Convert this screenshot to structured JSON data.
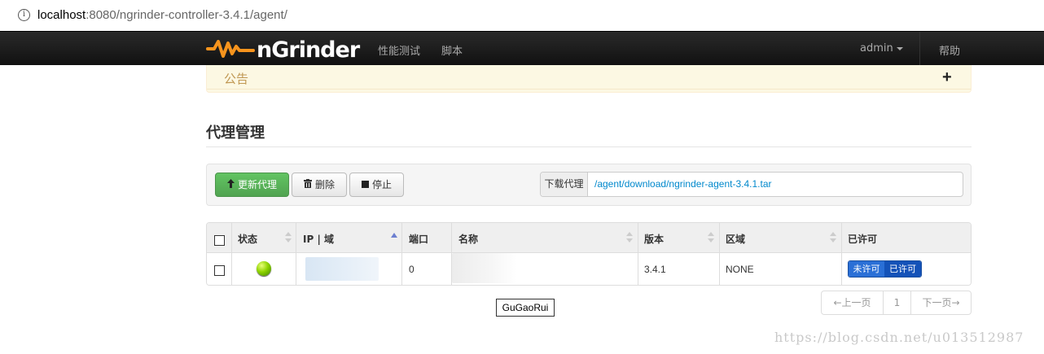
{
  "browser": {
    "url_host": "localhost",
    "url_rest": ":8080/ngrinder-controller-3.4.1/agent/",
    "info_glyph": "i"
  },
  "navbar": {
    "brand": "nGrinder",
    "items": [
      {
        "label": "性能测试"
      },
      {
        "label": "脚本"
      }
    ],
    "user": "admin",
    "help": "帮助",
    "logo_color": "#f7941d"
  },
  "notice": {
    "title": "公告",
    "expand_symbol": "+"
  },
  "page": {
    "title": "代理管理"
  },
  "toolbar": {
    "update_label": "更新代理",
    "delete_label": "删除",
    "stop_label": "停止",
    "download_label": "下载代理",
    "download_link": "/agent/download/ngrinder-agent-3.4.1.tar"
  },
  "table": {
    "headers": {
      "status": "状态",
      "ip": "IP | 域",
      "port": "端口",
      "name": "名称",
      "version": "版本",
      "region": "区域",
      "approved": "已许可"
    },
    "rows": [
      {
        "status": "green",
        "port": "0",
        "version": "3.4.1",
        "region": "NONE",
        "toggle_off": "未许可",
        "toggle_on": "已许可"
      }
    ]
  },
  "pagination": {
    "prev": "←上一页",
    "page": "1",
    "next": "下一页→"
  },
  "tooltip": "GuGaoRui",
  "watermark": "https://blog.csdn.net/u013512987"
}
